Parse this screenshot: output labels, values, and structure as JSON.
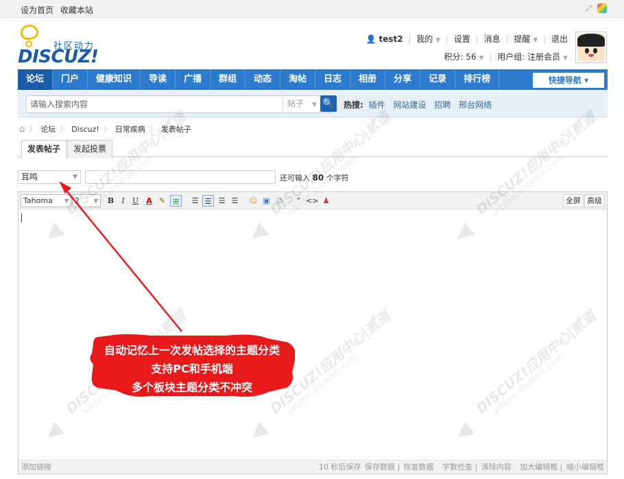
{
  "topbar": {
    "links": [
      "设为首页",
      "收藏本站"
    ],
    "icons": [
      "expand-icon",
      "colorful-app-icon"
    ]
  },
  "logo": {
    "slogan": "社区动力",
    "word": "DISCUZ!"
  },
  "user": {
    "name": "test2",
    "menu": [
      "我的",
      "设置",
      "消息",
      "提醒",
      "退出"
    ],
    "points": "积分: 56",
    "group": "用户组: 注册会员"
  },
  "nav": {
    "items": [
      "论坛",
      "门户",
      "健康知识",
      "导读",
      "广播",
      "群组",
      "动态",
      "淘帖",
      "日志",
      "相册",
      "分享",
      "记录",
      "排行榜"
    ],
    "quick": "快捷导航"
  },
  "search": {
    "placeholder": "请输入搜索内容",
    "type": "帖子",
    "hot_label": "热搜:",
    "hot_words": [
      "插件",
      "网站建设",
      "招聘",
      "邢台网络"
    ]
  },
  "breadcrumb": [
    "论坛",
    "Discuz!",
    "日常疾病",
    "发表帖子"
  ],
  "tabs": [
    "发表帖子",
    "发起投票"
  ],
  "form": {
    "type_selected": "耳鸣",
    "subject_value": "",
    "remaining_prefix": "还可输入",
    "remaining_count": "80",
    "remaining_suffix": "个字符"
  },
  "toolbar": {
    "font": "Tahoma",
    "size": "2",
    "bold": "B",
    "italic": "I",
    "underline": "U",
    "color": "A",
    "quote": "“",
    "code": "<>",
    "fullscreen": "全屏",
    "advanced": "高级"
  },
  "statusbar": {
    "left": "添加链接",
    "autosave": "10 秒后保存",
    "items": [
      "保存数据",
      "恢复数据",
      "字数检查",
      "清除内容",
      "加大编辑框",
      "缩小编辑框"
    ]
  },
  "annotation": {
    "lines": [
      "自动记忆上一次发帖选择的主题分类",
      "支持PC和手机端",
      "多个板块主题分类不冲突"
    ],
    "color": "#e8191b"
  }
}
